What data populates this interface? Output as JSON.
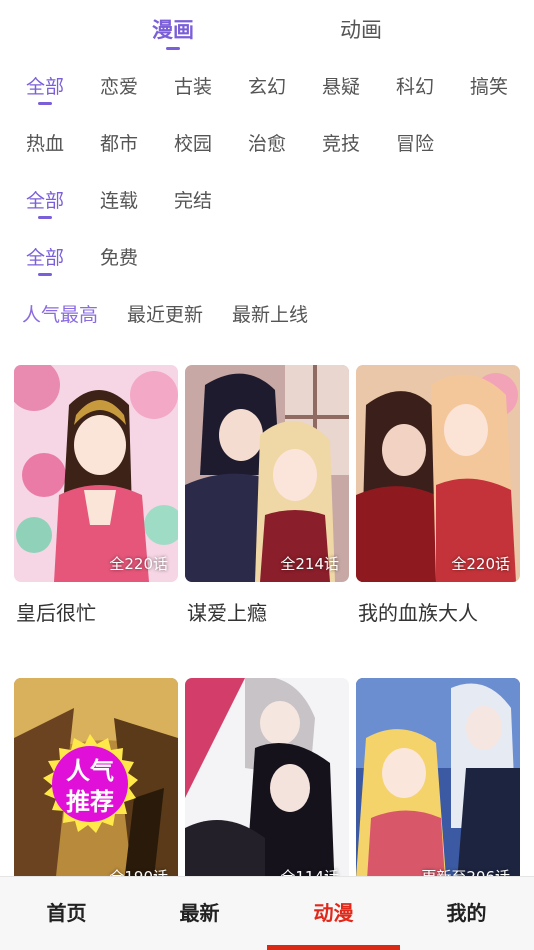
{
  "top_tabs": [
    {
      "label": "漫画",
      "active": true
    },
    {
      "label": "动画",
      "active": false
    }
  ],
  "genre_row1": [
    "全部",
    "恋爱",
    "古装",
    "玄幻",
    "悬疑",
    "科幻",
    "搞笑"
  ],
  "genre_row2": [
    "热血",
    "都市",
    "校园",
    "治愈",
    "竞技",
    "冒险"
  ],
  "status_filters": [
    "全部",
    "连载",
    "完结"
  ],
  "price_filters": [
    "全部",
    "免费"
  ],
  "sort_options": [
    "人气最高",
    "最近更新",
    "最新上线"
  ],
  "comics": [
    {
      "title": "皇后很忙",
      "episodes": "全220话"
    },
    {
      "title": "谋爱上瘾",
      "episodes": "全214话"
    },
    {
      "title": "我的血族大人",
      "episodes": "全220话"
    },
    {
      "title": "",
      "episodes": "全190话"
    },
    {
      "title": "",
      "episodes": "全114话"
    },
    {
      "title": "",
      "episodes": "更新至206话"
    }
  ],
  "badge": {
    "line1": "人气",
    "line2": "推荐"
  },
  "bottom_nav": [
    {
      "label": "首页",
      "active": false
    },
    {
      "label": "最新",
      "active": false
    },
    {
      "label": "动漫",
      "active": true
    },
    {
      "label": "我的",
      "active": false
    }
  ],
  "colors": {
    "accent": "#7b5fd9",
    "nav_active": "#e0291b",
    "badge": "#e010d8"
  }
}
